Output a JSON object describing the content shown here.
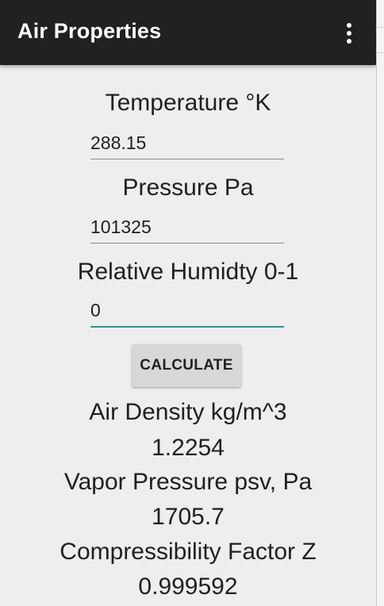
{
  "app_bar": {
    "title": "Air Properties",
    "menu_icon": "more-vert-icon"
  },
  "form": {
    "temperature": {
      "label": "Temperature °K",
      "value": "288.15"
    },
    "pressure": {
      "label": "Pressure Pa",
      "value": "101325"
    },
    "humidity": {
      "label": "Relative Humidty 0-1",
      "value": "0"
    },
    "calculate_label": "CALCULATE"
  },
  "results": {
    "density_label": "Air Density kg/m^3",
    "density_value": "1.2254",
    "vapor_label": "Vapor Pressure psv, Pa",
    "vapor_value": "1705.7",
    "z_label": "Compressibility Factor Z",
    "z_value": "0.999592"
  },
  "colors": {
    "app_bar": "#212121",
    "background": "#eeeeee",
    "focus_accent": "#3a8f86",
    "button": "#d8d8d8"
  }
}
